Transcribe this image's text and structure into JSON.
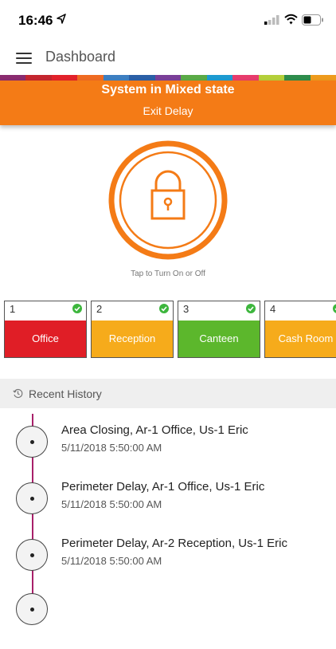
{
  "status_bar": {
    "time": "16:46",
    "icons": [
      "location-arrow-icon",
      "cellular-signal-icon",
      "wifi-icon",
      "battery-icon"
    ]
  },
  "app_bar": {
    "title": "Dashboard",
    "menu_icon": "hamburger-menu-icon"
  },
  "banner": {
    "state": "System in Mixed state",
    "substate": "Exit Delay",
    "color": "#f47b16"
  },
  "rainbow_colors": [
    "#8a2b6f",
    "#c4262e",
    "#e2222a",
    "#ef6b22",
    "#3d7fc1",
    "#2b5fa6",
    "#7a3f98",
    "#5aaa46",
    "#1d9bd1",
    "#e73c6c",
    "#b4cf3a",
    "#2e8c4b",
    "#ee9b1d"
  ],
  "lock": {
    "hint": "Tap to Turn On or Off",
    "icon": "padlock-icon",
    "color": "#f47b16"
  },
  "areas": [
    {
      "number": "1",
      "name": "Office",
      "color": "#e01e26",
      "status_icon": "check-icon"
    },
    {
      "number": "2",
      "name": "Reception",
      "color": "#f6ab1b",
      "status_icon": "check-icon"
    },
    {
      "number": "3",
      "name": "Canteen",
      "color": "#5cb72c",
      "status_icon": "check-icon"
    },
    {
      "number": "4",
      "name": "Cash Room",
      "color": "#f6ab1b",
      "status_icon": "check-icon"
    }
  ],
  "recent_history": {
    "title": "Recent History",
    "icon": "history-icon",
    "items": [
      {
        "title": "Area Closing, Ar-1 Office, Us-1 Eric",
        "time": "5/11/2018 5:50:00 AM"
      },
      {
        "title": "Perimeter Delay, Ar-1 Office, Us-1 Eric",
        "time": "5/11/2018 5:50:00 AM"
      },
      {
        "title": "Perimeter Delay, Ar-2 Reception, Us-1 Eric",
        "time": "5/11/2018 5:50:00 AM"
      }
    ]
  }
}
